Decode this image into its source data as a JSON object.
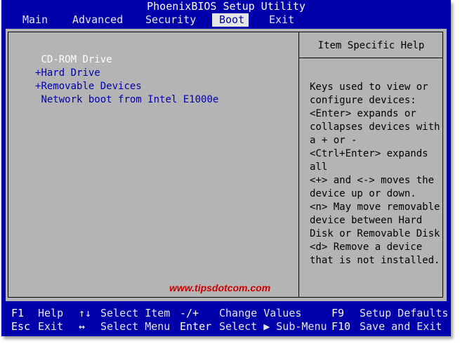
{
  "title": "PhoenixBIOS Setup Utility",
  "menu": {
    "items": [
      "Main",
      "Advanced",
      "Security",
      "Boot",
      "Exit"
    ],
    "active": "Boot"
  },
  "boot": {
    "items": [
      {
        "prefix": " ",
        "label": "CD-ROM Drive"
      },
      {
        "prefix": "+",
        "label": "Hard Drive"
      },
      {
        "prefix": "+",
        "label": "Removable Devices"
      },
      {
        "prefix": " ",
        "label": "Network boot from Intel E1000e"
      }
    ],
    "selected_index": 0
  },
  "help": {
    "title": "Item Specific Help",
    "lines": [
      "Keys used to view or",
      "configure devices:",
      "<Enter> expands or",
      "collapses devices with",
      "a + or -",
      "<Ctrl+Enter> expands",
      "all",
      "<+> and <-> moves the",
      "device up or down.",
      "<n> May move removable",
      "device between Hard",
      "Disk or Removable Disk",
      "<d> Remove a device",
      "that is not installed."
    ]
  },
  "watermark": "www.tipsdotcom.com",
  "footer": {
    "row1": {
      "key1": "F1",
      "desc1": "Help",
      "key2": "↑↓",
      "desc2": "Select Item",
      "key3": "-/+",
      "desc3": "Change Values",
      "key4": "F9",
      "desc4": "Setup Defaults"
    },
    "row2": {
      "key1": "Esc",
      "desc1": "Exit",
      "key2": "↔",
      "desc2": "Select Menu",
      "key3": "Enter",
      "desc3": "Select ▶ Sub-Menu",
      "key4": "F10",
      "desc4": "Save and Exit"
    }
  },
  "colors": {
    "background": "#0000aa",
    "panel": "#b4b4b4",
    "menu_active_bg": "#e6e6e6",
    "selected_item": "#ffffff",
    "watermark": "#cc0000"
  }
}
